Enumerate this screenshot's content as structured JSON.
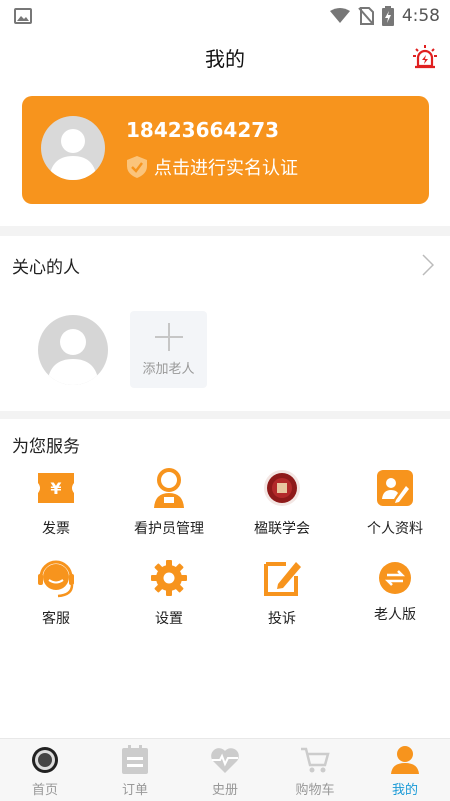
{
  "status_bar": {
    "time": "4:58"
  },
  "header": {
    "title": "我的"
  },
  "profile": {
    "phone": "18423664273",
    "verify_text": "点击进行实名认证"
  },
  "care": {
    "title": "关心的人",
    "add_label": "添加老人"
  },
  "services": {
    "title": "为您服务",
    "items": [
      {
        "label": "发票",
        "icon": "ticket-icon"
      },
      {
        "label": "看护员管理",
        "icon": "caregiver-icon"
      },
      {
        "label": "楹联学会",
        "icon": "society-seal-icon"
      },
      {
        "label": "个人资料",
        "icon": "profile-edit-icon"
      },
      {
        "label": "客服",
        "icon": "headset-icon"
      },
      {
        "label": "设置",
        "icon": "gear-icon"
      },
      {
        "label": "投诉",
        "icon": "complaint-edit-icon"
      },
      {
        "label": "老人版",
        "icon": "elder-mode-icon"
      }
    ]
  },
  "tabs": [
    {
      "label": "首页",
      "icon": "home-seal-icon"
    },
    {
      "label": "订单",
      "icon": "order-icon"
    },
    {
      "label": "史册",
      "icon": "heart-pulse-icon"
    },
    {
      "label": "购物车",
      "icon": "cart-icon"
    },
    {
      "label": "我的",
      "icon": "user-icon",
      "active": true
    }
  ],
  "colors": {
    "accent": "#f7941d",
    "active_tab": "#1a9ad6"
  }
}
